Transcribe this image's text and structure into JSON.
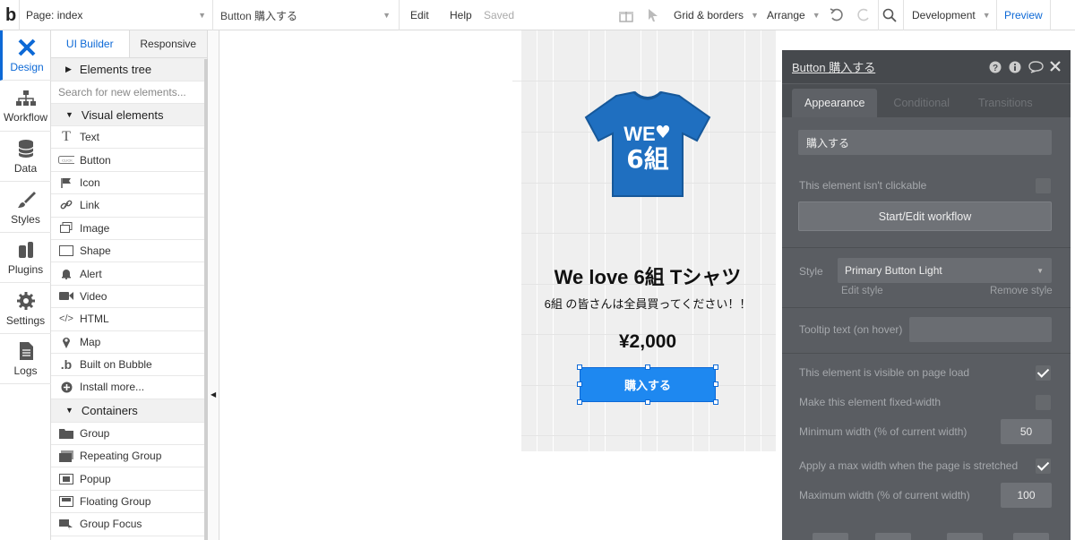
{
  "topbar": {
    "logo": "b",
    "page_label": "Page: index",
    "element_label": "Button 購入する",
    "edit": "Edit",
    "help": "Help",
    "saved": "Saved",
    "grid_borders": "Grid & borders",
    "arrange": "Arrange",
    "environment": "Development",
    "preview": "Preview"
  },
  "leftnav": {
    "items": [
      {
        "label": "Design",
        "icon": "design-icon"
      },
      {
        "label": "Workflow",
        "icon": "workflow-icon"
      },
      {
        "label": "Data",
        "icon": "database-icon"
      },
      {
        "label": "Styles",
        "icon": "brush-icon"
      },
      {
        "label": "Plugins",
        "icon": "plug-icon"
      },
      {
        "label": "Settings",
        "icon": "gear-icon"
      },
      {
        "label": "Logs",
        "icon": "document-icon"
      }
    ]
  },
  "palette": {
    "tabs": [
      "UI Builder",
      "Responsive"
    ],
    "elements_tree": "Elements tree",
    "search_placeholder": "Search for new elements...",
    "visual_section": "Visual elements",
    "visual_items": [
      {
        "label": "Text",
        "icon": "text-icon"
      },
      {
        "label": "Button",
        "icon": "button-icon"
      },
      {
        "label": "Icon",
        "icon": "flag-icon"
      },
      {
        "label": "Link",
        "icon": "link-icon"
      },
      {
        "label": "Image",
        "icon": "image-icon"
      },
      {
        "label": "Shape",
        "icon": "shape-icon"
      },
      {
        "label": "Alert",
        "icon": "bell-icon"
      },
      {
        "label": "Video",
        "icon": "video-icon"
      },
      {
        "label": "HTML",
        "icon": "code-icon"
      },
      {
        "label": "Map",
        "icon": "map-pin-icon"
      },
      {
        "label": "Built on Bubble",
        "icon": "bubble-logo-icon"
      },
      {
        "label": "Install more...",
        "icon": "plus-circle-icon"
      }
    ],
    "containers_section": "Containers",
    "container_items": [
      {
        "label": "Group",
        "icon": "folder-icon"
      },
      {
        "label": "Repeating Group",
        "icon": "repeating-group-icon"
      },
      {
        "label": "Popup",
        "icon": "popup-icon"
      },
      {
        "label": "Floating Group",
        "icon": "floating-group-icon"
      },
      {
        "label": "Group Focus",
        "icon": "group-focus-icon"
      }
    ]
  },
  "canvas": {
    "shirt_text_line1": "WE",
    "shirt_text_line2": "6組",
    "shirt_color": "#1f6fc0",
    "product_title": "We love 6組 Tシャツ",
    "product_subtitle": "6組 の皆さんは全員買ってください！！",
    "price": "¥2,000",
    "buy_button": "購入する",
    "button_color": "#1e88f0"
  },
  "panel": {
    "title": "Button 購入する",
    "tabs": [
      "Appearance",
      "Conditional",
      "Transitions"
    ],
    "text_value": "購入する",
    "not_clickable_label": "This element isn't clickable",
    "not_clickable_checked": false,
    "workflow_button": "Start/Edit workflow",
    "style_label": "Style",
    "style_value": "Primary Button Light",
    "edit_style": "Edit style",
    "remove_style": "Remove style",
    "tooltip_label": "Tooltip text (on hover)",
    "tooltip_value": "",
    "visible_label": "This element is visible on page load",
    "visible_checked": true,
    "fixed_width_label": "Make this element fixed-width",
    "fixed_width_checked": false,
    "min_width_label": "Minimum width (% of current width)",
    "min_width_value": "50",
    "max_width_apply_label": "Apply a max width when the page is stretched",
    "max_width_apply_checked": true,
    "max_width_label": "Maximum width (% of current width)",
    "max_width_value": "100"
  }
}
